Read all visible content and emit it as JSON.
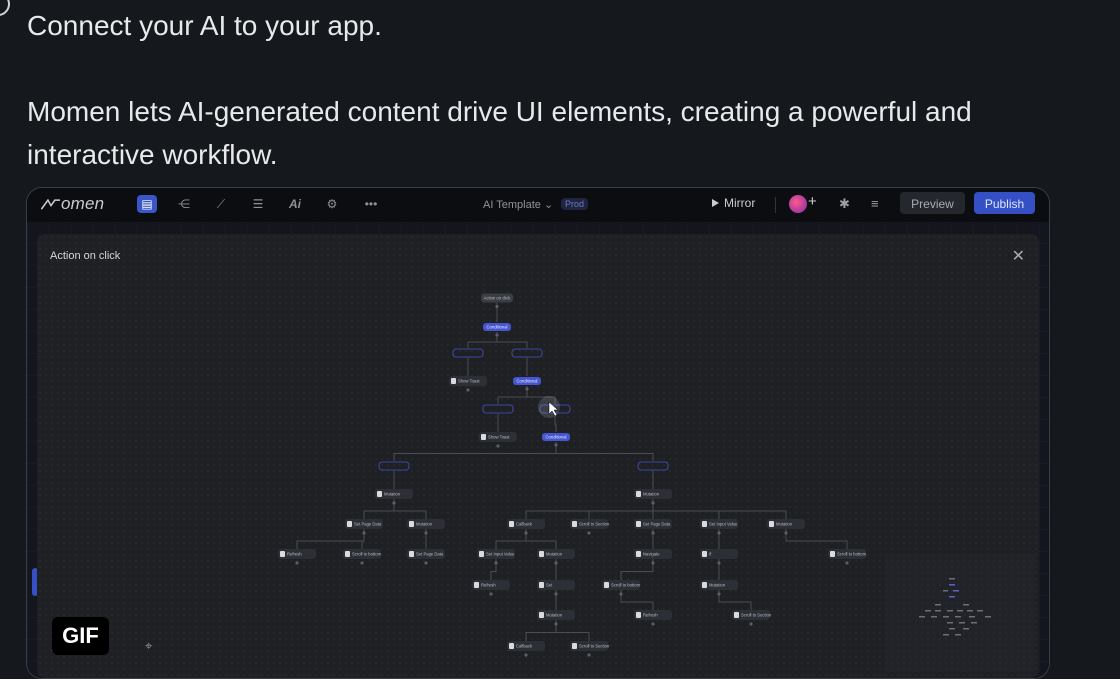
{
  "tweet": {
    "line1": "Connect your AI to your app.",
    "line2": "Momen lets AI-generated content drive UI elements, creating a powerful and interactive workflow."
  },
  "app": {
    "logo_text": "omen",
    "template_name": "AI Template",
    "env_badge": "Prod",
    "mirror_label": "Mirror",
    "preview_label": "Preview",
    "publish_label": "Publish",
    "accent_color": "#3550c4",
    "toolbar_icons": [
      "pages-icon",
      "tree-icon",
      "wand-icon",
      "layers-icon",
      "ai-icon",
      "gear-icon",
      "more-icon"
    ]
  },
  "modal": {
    "title": "Action on click"
  },
  "zoom": {
    "minus": "−",
    "plus": "+"
  },
  "gif_badge": "GIF",
  "flow_nodes": [
    {
      "id": "root",
      "label": "Action on click",
      "type": "start"
    },
    {
      "id": "c1",
      "label": "Conditional",
      "type": "cond"
    },
    {
      "id": "b1l",
      "label": "",
      "type": "branch"
    },
    {
      "id": "b1r",
      "label": "",
      "type": "branch"
    },
    {
      "id": "t1",
      "label": "Show Toast",
      "type": "action"
    },
    {
      "id": "c2",
      "label": "Conditional",
      "type": "cond"
    },
    {
      "id": "b2l",
      "label": "",
      "type": "branch"
    },
    {
      "id": "b2r",
      "label": "",
      "type": "branch"
    },
    {
      "id": "t2",
      "label": "Show Toast",
      "type": "action"
    },
    {
      "id": "c3",
      "label": "Conditional",
      "type": "cond"
    },
    {
      "id": "b3l",
      "label": "",
      "type": "branch"
    },
    {
      "id": "b3r",
      "label": "",
      "type": "branch"
    },
    {
      "id": "m1",
      "label": "Mutation",
      "type": "action"
    },
    {
      "id": "m2",
      "label": "Mutation",
      "type": "action"
    },
    {
      "id": "a1",
      "label": "Set Page Data",
      "type": "action"
    },
    {
      "id": "a2",
      "label": "Mutation",
      "type": "action"
    },
    {
      "id": "a3",
      "label": "Callback",
      "type": "action"
    },
    {
      "id": "a4",
      "label": "Scroll to Section",
      "type": "action"
    },
    {
      "id": "a5",
      "label": "Set Page Data",
      "type": "action"
    },
    {
      "id": "a6",
      "label": "Set Input Value",
      "type": "action"
    },
    {
      "id": "a7",
      "label": "Mutation",
      "type": "action"
    },
    {
      "id": "d1",
      "label": "Refresh",
      "type": "action"
    },
    {
      "id": "d2",
      "label": "Scroll to bottom",
      "type": "action"
    },
    {
      "id": "d3",
      "label": "Set Page Data",
      "type": "action"
    },
    {
      "id": "d4",
      "label": "Set Input Value",
      "type": "action"
    },
    {
      "id": "d5",
      "label": "Mutation",
      "type": "action"
    },
    {
      "id": "d6",
      "label": "Navigate",
      "type": "action"
    },
    {
      "id": "d7",
      "label": "If",
      "type": "action"
    },
    {
      "id": "d8",
      "label": "Scroll to bottom",
      "type": "action"
    },
    {
      "id": "e1",
      "label": "Refresh",
      "type": "action"
    },
    {
      "id": "e2",
      "label": "Set",
      "type": "action"
    },
    {
      "id": "e3",
      "label": "Scroll to bottom",
      "type": "action"
    },
    {
      "id": "e4",
      "label": "Mutation",
      "type": "action"
    },
    {
      "id": "f1",
      "label": "Mutation",
      "type": "action"
    },
    {
      "id": "f2",
      "label": "Refresh",
      "type": "action"
    },
    {
      "id": "f3",
      "label": "Scroll to Section",
      "type": "action"
    },
    {
      "id": "g1",
      "label": "Callback",
      "type": "action"
    },
    {
      "id": "g2",
      "label": "Scroll to Section",
      "type": "action"
    }
  ]
}
